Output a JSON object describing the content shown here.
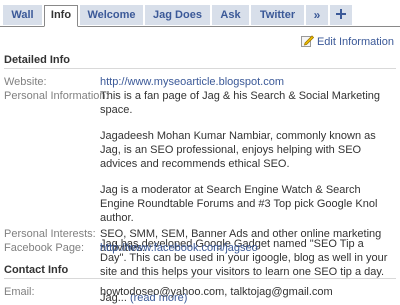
{
  "tabs": [
    {
      "label": "Wall",
      "active": false
    },
    {
      "label": "Info",
      "active": true
    },
    {
      "label": "Welcome",
      "active": false
    },
    {
      "label": "Jag Does",
      "active": false
    },
    {
      "label": "Ask",
      "active": false
    },
    {
      "label": "Twitter",
      "active": false
    },
    {
      "label": "»",
      "active": false
    },
    {
      "label": "",
      "icon": "plus-icon",
      "active": false
    }
  ],
  "edit_link": {
    "label": "Edit Information",
    "icon": "pencil-icon"
  },
  "detailed_info": {
    "title": "Detailed Info",
    "website_label": "Website:",
    "website_value": "http://www.myseoarticle.blogspot.com",
    "personal_label": "Personal Information:",
    "personal_paragraphs": [
      "This is a fan page of Jag & his Search & Social Marketing space.",
      "Jagadeesh Mohan Kumar Nambiar, commonly known as Jag, is an SEO professional, enjoys helping with SEO advices and recommends ethical SEO.",
      "Jag is a moderator at Search Engine Watch & Search Engine Roundtable Forums and #3 Top pick Google Knol author.",
      "Jag has developed Google Gadget named \"SEO Tip a Day\". This can be used in your igoogle, blog as well in your site and this helps your visitors to learn one SEO tip a day."
    ],
    "personal_truncated": "Jag...",
    "read_more": "(read more)",
    "interests_label": "Personal Interests:",
    "interests_value": "SEO, SMM, SEM, Banner Ads and other online marketing activities.",
    "facebook_label": "Facebook Page:",
    "facebook_value": "http://www.facebook.com/jagseo"
  },
  "contact_info": {
    "title": "Contact Info",
    "email_label": "Email:",
    "email_value": "howtodoseo@yahoo.com, talktojag@gmail.com"
  }
}
